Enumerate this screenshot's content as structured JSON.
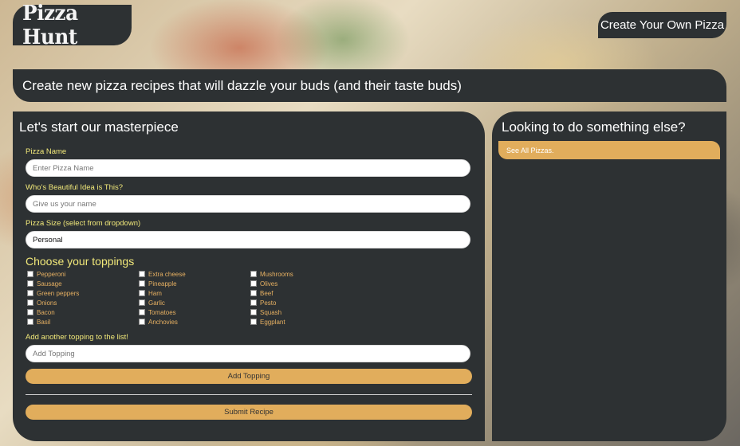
{
  "header": {
    "logo": "Pizza Hunt",
    "create_link": "Create Your Own Pizza"
  },
  "tagline": "Create new pizza recipes that will dazzle your buds (and their taste buds)",
  "form": {
    "title": "Let's start our masterpiece",
    "name_label": "Pizza Name",
    "name_placeholder": "Enter Pizza Name",
    "author_label": "Who's Beautiful Idea is This?",
    "author_placeholder": "Give us your name",
    "size_label": "Pizza Size (select from dropdown)",
    "size_value": "Personal",
    "toppings_title": "Choose your toppings",
    "toppings": [
      "Pepperoni",
      "Extra cheese",
      "Mushrooms",
      "Sausage",
      "Pineapple",
      "Olives",
      "Green peppers",
      "Ham",
      "Beef",
      "Onions",
      "Garlic",
      "Pesto",
      "Bacon",
      "Tomatoes",
      "Squash",
      "Basil",
      "Anchovies",
      "Eggplant"
    ],
    "add_topping_label": "Add another topping to the list!",
    "add_topping_placeholder": "Add Topping",
    "add_topping_button": "Add Topping",
    "submit_button": "Submit Recipe"
  },
  "sidebar": {
    "title": "Looking to do something else?",
    "see_all": "See All Pizzas."
  },
  "colors": {
    "panel": "#2d3133",
    "accent": "#e1ad5c",
    "label": "#f2e97a",
    "topping_text": "#e6b062"
  }
}
